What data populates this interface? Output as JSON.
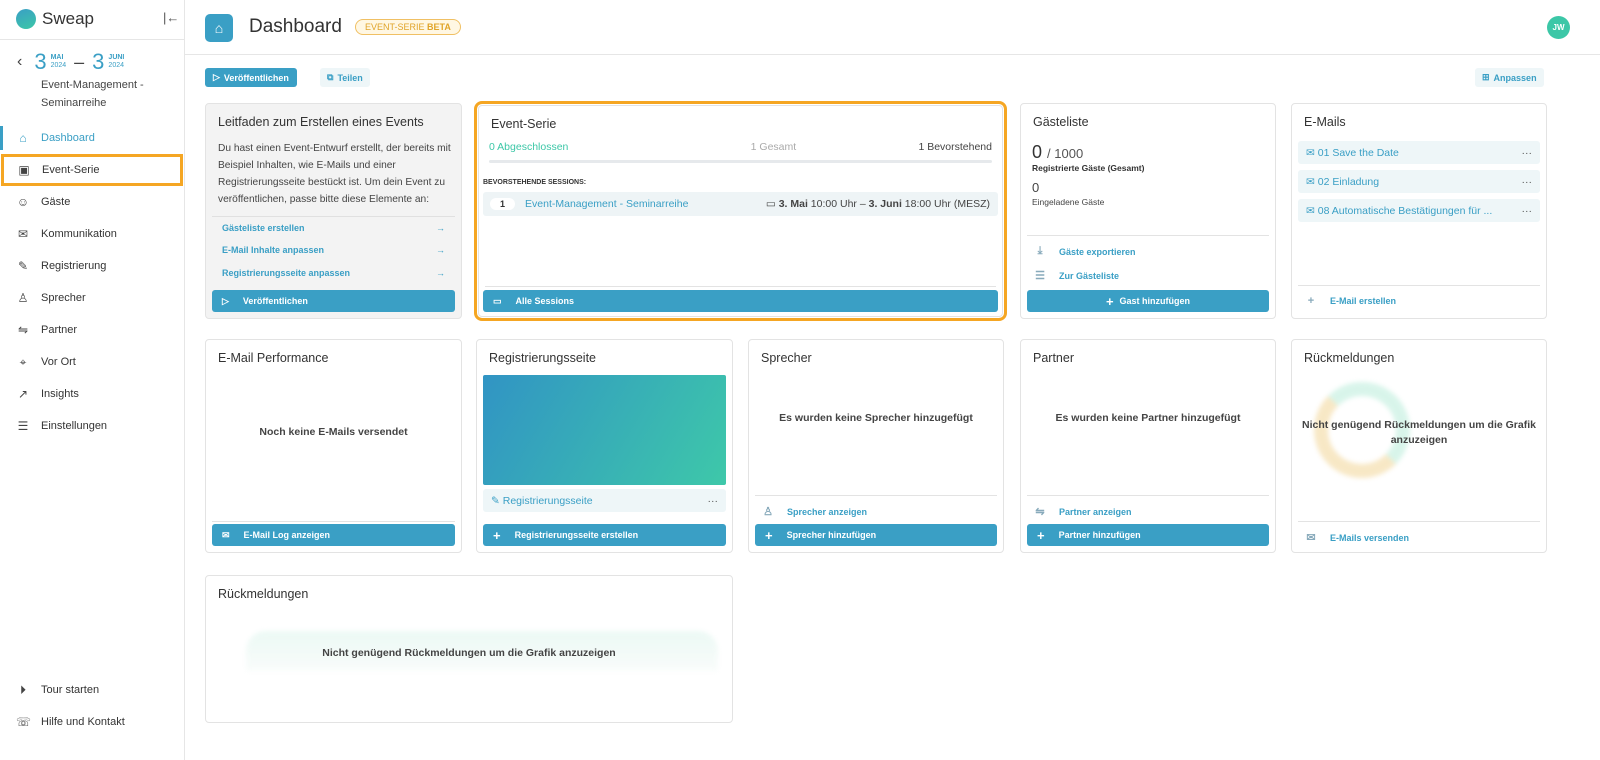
{
  "app": {
    "name": "Sweap"
  },
  "event": {
    "start_day": "3",
    "start_month": "MAI",
    "start_year": "2024",
    "end_day": "3",
    "end_month": "JUNI",
    "end_year": "2024",
    "name": "Event-Management - Seminarreihe"
  },
  "sidebar": {
    "items": [
      {
        "label": "Dashboard",
        "icon": "home-icon",
        "active": true
      },
      {
        "label": "Event-Serie",
        "icon": "calendar-icon",
        "highlighted": true
      },
      {
        "label": "Gäste",
        "icon": "user-check-icon"
      },
      {
        "label": "Kommunikation",
        "icon": "mail-icon"
      },
      {
        "label": "Registrierung",
        "icon": "edit-icon"
      },
      {
        "label": "Sprecher",
        "icon": "speaker-icon"
      },
      {
        "label": "Partner",
        "icon": "handshake-icon"
      },
      {
        "label": "Vor Ort",
        "icon": "map-icon"
      },
      {
        "label": "Insights",
        "icon": "chart-icon"
      },
      {
        "label": "Einstellungen",
        "icon": "sliders-icon"
      }
    ],
    "bottom": [
      {
        "label": "Tour starten",
        "icon": "play-circle-icon"
      },
      {
        "label": "Hilfe und Kontakt",
        "icon": "help-chat-icon"
      }
    ]
  },
  "header": {
    "title": "Dashboard",
    "badge": "EVENT-SERIE",
    "badge_strong": "BETA",
    "avatar": "JW"
  },
  "toolbar": {
    "publish": "Veröffentlichen",
    "share": "Teilen",
    "customize": "Anpassen"
  },
  "colors": {
    "accent": "#3a9fc5",
    "highlight": "#f5a623",
    "success": "#3cc7a7"
  },
  "guide": {
    "title": "Leitfaden zum Erstellen eines Events",
    "text": "Du hast einen Event-Entwurf erstellt, der bereits mit Beispiel Inhalten, wie E-Mails und einer Registrierungsseite bestückt ist. Um dein Event zu veröffentlichen, passe bitte diese Elemente an:",
    "links": [
      "Gästeliste erstellen",
      "E-Mail Inhalte anpassen",
      "Registrierungsseite anpassen"
    ],
    "button": "Veröffentlichen"
  },
  "series": {
    "title": "Event-Serie",
    "completed": "0 Abgeschlossen",
    "total": "1 Gesamt",
    "upcoming": "1 Bevorstehend",
    "progress_percent": 0,
    "sessions_label": "BEVORSTEHENDE SESSIONS:",
    "sessions": [
      {
        "num": "1",
        "name": "Event-Management - Seminarreihe",
        "start_date": "3. Mai",
        "start_time": "10:00 Uhr",
        "sep": "–",
        "end_date": "3. Juni",
        "end_time": "18:00 Uhr (MESZ)"
      }
    ],
    "button": "Alle Sessions"
  },
  "guests": {
    "title": "Gästeliste",
    "registered": "0",
    "capacity": "/ 1000",
    "registered_label": "Registrierte Gäste (Gesamt)",
    "invited": "0",
    "invited_label": "Eingeladene Gäste",
    "export": "Gäste exportieren",
    "to_list": "Zur Gästeliste",
    "button": "Gast hinzufügen"
  },
  "emails": {
    "title": "E-Mails",
    "items": [
      "01 Save the Date",
      "02 Einladung",
      "08 Automatische Bestätigungen für ..."
    ],
    "create": "E-Mail erstellen"
  },
  "email_perf": {
    "title": "E-Mail Performance",
    "empty": "Noch keine E-Mails versendet",
    "button": "E-Mail Log anzeigen"
  },
  "regpage": {
    "title": "Registrierungsseite",
    "item": "Registrierungsseite",
    "button": "Registrierungsseite erstellen"
  },
  "speakers": {
    "title": "Sprecher",
    "empty": "Es wurden keine Sprecher hinzugefügt",
    "show": "Sprecher anzeigen",
    "button": "Sprecher hinzufügen"
  },
  "partners": {
    "title": "Partner",
    "empty": "Es wurden keine Partner hinzugefügt",
    "show": "Partner anzeigen",
    "button": "Partner hinzufügen"
  },
  "feedback": {
    "title": "Rückmeldungen",
    "empty": "Nicht genügend Rückmeldungen um die Grafik anzuzeigen",
    "send": "E-Mails versenden"
  },
  "feedback_chart": {
    "title": "Rückmeldungen",
    "empty": "Nicht genügend Rückmeldungen um die Grafik anzuzeigen"
  }
}
